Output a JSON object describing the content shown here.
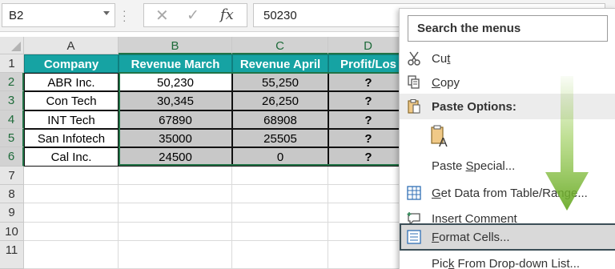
{
  "namebox": {
    "value": "B2"
  },
  "formula": {
    "value": "50230",
    "fx_label": "fx"
  },
  "columns": [
    "A",
    "B",
    "C",
    "D"
  ],
  "rows": [
    "1",
    "2",
    "3",
    "4",
    "5",
    "6",
    "7",
    "8",
    "9",
    "10",
    "11"
  ],
  "table": {
    "headers": [
      "Company",
      "Revenue March",
      "Revenue April",
      "Profit/Los"
    ],
    "data": [
      [
        "ABR Inc.",
        "50,230",
        "55,250",
        "?"
      ],
      [
        "Con Tech",
        "30,345",
        "26,250",
        "?"
      ],
      [
        "INT Tech",
        "67890",
        "68908",
        "?"
      ],
      [
        "San Infotech",
        "35000",
        "25505",
        "?"
      ],
      [
        "Cal Inc.",
        "24500",
        "0",
        "?"
      ]
    ]
  },
  "context_menu": {
    "search_placeholder": "Search the menus",
    "cut": {
      "pre": "Cu",
      "u": "t",
      "post": ""
    },
    "copy": {
      "pre": "",
      "u": "C",
      "post": "opy"
    },
    "paste_options": "Paste Options:",
    "paste_special": {
      "pre": "Paste ",
      "u": "S",
      "post": "pecial..."
    },
    "get_data": {
      "pre": "",
      "u": "G",
      "post": "et Data from Table/Range..."
    },
    "insert_comment": {
      "pre": "Insert Co",
      "u": "m",
      "post": "ment"
    },
    "format_cells": {
      "pre": "",
      "u": "F",
      "post": "ormat Cells..."
    },
    "pick_list": {
      "pre": "Pic",
      "u": "k",
      "post": " From Drop-down List..."
    }
  },
  "colors": {
    "header_teal": "#16a3a3",
    "selection_green": "#217346",
    "arrow_green": "#8dc63f"
  }
}
